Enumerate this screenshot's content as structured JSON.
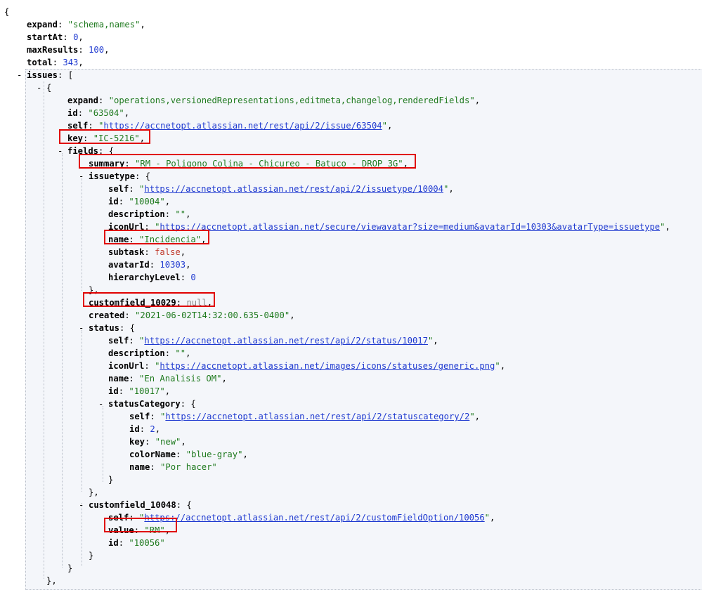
{
  "punct": {
    "open_brace": "{",
    "open_bracket": "[",
    "close_brace": "}",
    "close_brace_comma": "},",
    "collapse": "-"
  },
  "lines": [
    {
      "key": "expand",
      "type": "str",
      "value": "\"schema,names\"",
      "suffix": ","
    },
    {
      "key": "startAt",
      "type": "num",
      "value": "0",
      "suffix": ","
    },
    {
      "key": "maxResults",
      "type": "num",
      "value": "100",
      "suffix": ","
    },
    {
      "key": "total",
      "type": "num",
      "value": "343",
      "suffix": ","
    },
    {
      "key": "issues",
      "type": "open",
      "value": "[",
      "suffix": ""
    },
    {
      "key": "",
      "type": "open",
      "value": "{",
      "suffix": ""
    },
    {
      "key": "expand",
      "type": "str",
      "value": "\"operations,versionedRepresentations,editmeta,changelog,renderedFields\"",
      "suffix": ","
    },
    {
      "key": "id",
      "type": "str",
      "value": "\"63504\"",
      "suffix": ","
    },
    {
      "key": "self",
      "type": "url",
      "value": "https://accnetopt.atlassian.net/rest/api/2/issue/63504",
      "suffix": ","
    },
    {
      "key": "key",
      "type": "str",
      "value": "\"IC-5216\"",
      "suffix": ","
    },
    {
      "key": "fields",
      "type": "open",
      "value": "{",
      "suffix": ""
    },
    {
      "key": "summary",
      "type": "str",
      "value": "\"RM - Poligono Colina - Chicureo - Batuco - DROP_3G\"",
      "suffix": ","
    },
    {
      "key": "issuetype",
      "type": "open",
      "value": "{",
      "suffix": ""
    },
    {
      "key": "self",
      "type": "url",
      "value": "https://accnetopt.atlassian.net/rest/api/2/issuetype/10004",
      "suffix": ","
    },
    {
      "key": "id",
      "type": "str",
      "value": "\"10004\"",
      "suffix": ","
    },
    {
      "key": "description",
      "type": "str",
      "value": "\"\"",
      "suffix": ","
    },
    {
      "key": "iconUrl",
      "type": "url",
      "value": "https://accnetopt.atlassian.net/secure/viewavatar?size=medium&avatarId=10303&avatarType=issuetype",
      "suffix": ","
    },
    {
      "key": "name",
      "type": "str",
      "value": "\"Incidencia\"",
      "suffix": ","
    },
    {
      "key": "subtask",
      "type": "bool",
      "value": "false",
      "suffix": ","
    },
    {
      "key": "avatarId",
      "type": "num",
      "value": "10303",
      "suffix": ","
    },
    {
      "key": "hierarchyLevel",
      "type": "num",
      "value": "0",
      "suffix": ""
    },
    {
      "key": "",
      "type": "close",
      "value": "},",
      "suffix": ""
    },
    {
      "key": "customfield_10029",
      "type": "null",
      "value": "null",
      "suffix": ","
    },
    {
      "key": "created",
      "type": "str",
      "value": "\"2021-06-02T14:32:00.635-0400\"",
      "suffix": ","
    },
    {
      "key": "status",
      "type": "open",
      "value": "{",
      "suffix": ""
    },
    {
      "key": "self",
      "type": "url",
      "value": "https://accnetopt.atlassian.net/rest/api/2/status/10017",
      "suffix": ","
    },
    {
      "key": "description",
      "type": "str",
      "value": "\"\"",
      "suffix": ","
    },
    {
      "key": "iconUrl",
      "type": "url",
      "value": "https://accnetopt.atlassian.net/images/icons/statuses/generic.png",
      "suffix": ","
    },
    {
      "key": "name",
      "type": "str",
      "value": "\"En Analisis OM\"",
      "suffix": ","
    },
    {
      "key": "id",
      "type": "str",
      "value": "\"10017\"",
      "suffix": ","
    },
    {
      "key": "statusCategory",
      "type": "open",
      "value": "{",
      "suffix": ""
    },
    {
      "key": "self",
      "type": "url",
      "value": "https://accnetopt.atlassian.net/rest/api/2/statuscategory/2",
      "suffix": ","
    },
    {
      "key": "id",
      "type": "num",
      "value": "2",
      "suffix": ","
    },
    {
      "key": "key",
      "type": "str",
      "value": "\"new\"",
      "suffix": ","
    },
    {
      "key": "colorName",
      "type": "str",
      "value": "\"blue-gray\"",
      "suffix": ","
    },
    {
      "key": "name",
      "type": "str",
      "value": "\"Por hacer\"",
      "suffix": ""
    },
    {
      "key": "",
      "type": "close",
      "value": "}",
      "suffix": ""
    },
    {
      "key": "",
      "type": "close",
      "value": "},",
      "suffix": ""
    },
    {
      "key": "customfield_10048",
      "type": "open",
      "value": "{",
      "suffix": ""
    },
    {
      "key": "self",
      "type": "url",
      "value": "https://accnetopt.atlassian.net/rest/api/2/customFieldOption/10056",
      "suffix": ","
    },
    {
      "key": "value",
      "type": "str",
      "value": "\"RM\"",
      "suffix": ","
    },
    {
      "key": "id",
      "type": "str",
      "value": "\"10056\"",
      "suffix": ""
    },
    {
      "key": "",
      "type": "close",
      "value": "}",
      "suffix": ""
    },
    {
      "key": "",
      "type": "close",
      "value": "}",
      "suffix": ""
    },
    {
      "key": "",
      "type": "close",
      "value": "},",
      "suffix": ""
    }
  ]
}
